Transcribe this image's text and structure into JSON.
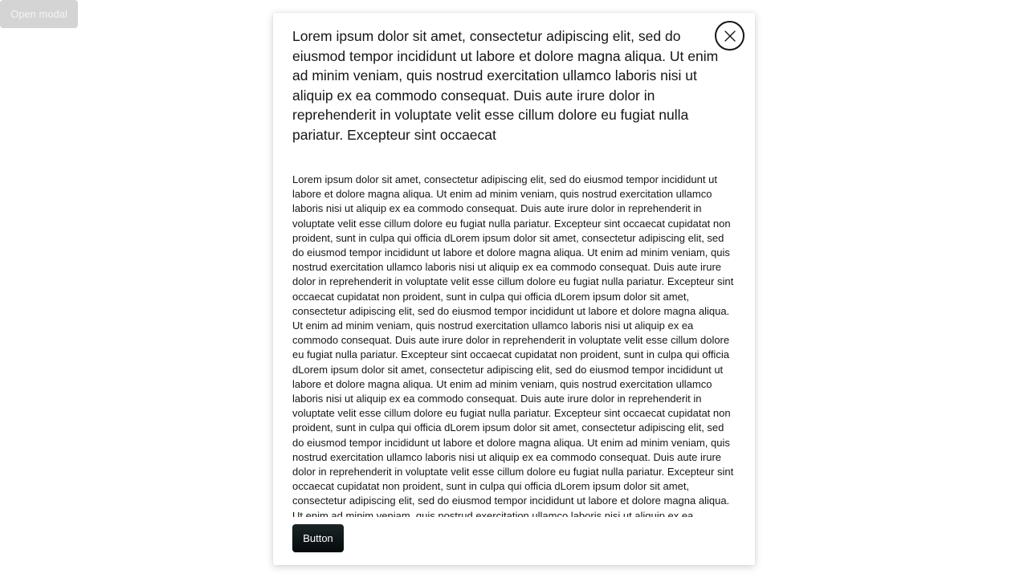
{
  "open_modal": {
    "label": "Open modal"
  },
  "modal": {
    "title": "Lorem ipsum dolor sit amet, consectetur adipiscing elit, sed do eiusmod tempor incididunt ut labore et dolore magna aliqua. Ut enim ad minim veniam, quis nostrud exercitation ullamco laboris nisi ut aliquip ex ea commodo consequat. Duis aute irure dolor in reprehenderit in voluptate velit esse cillum dolore eu fugiat nulla pariatur. Excepteur sint occaecat",
    "close_icon": "close-icon",
    "body": "Lorem ipsum dolor sit amet, consectetur adipiscing elit, sed do eiusmod tempor incididunt ut labore et dolore magna aliqua. Ut enim ad minim veniam, quis nostrud exercitation ullamco laboris nisi ut aliquip ex ea commodo consequat. Duis aute irure dolor in reprehenderit in voluptate velit esse cillum dolore eu fugiat nulla pariatur. Excepteur sint occaecat cupidatat non proident, sunt in culpa qui officia dLorem ipsum dolor sit amet, consectetur adipiscing elit, sed do eiusmod tempor incididunt ut labore et dolore magna aliqua. Ut enim ad minim veniam, quis nostrud exercitation ullamco laboris nisi ut aliquip ex ea commodo consequat. Duis aute irure dolor in reprehenderit in voluptate velit esse cillum dolore eu fugiat nulla pariatur. Excepteur sint occaecat cupidatat non proident, sunt in culpa qui officia dLorem ipsum dolor sit amet, consectetur adipiscing elit, sed do eiusmod tempor incididunt ut labore et dolore magna aliqua. Ut enim ad minim veniam, quis nostrud exercitation ullamco laboris nisi ut aliquip ex ea commodo consequat. Duis aute irure dolor in reprehenderit in voluptate velit esse cillum dolore eu fugiat nulla pariatur. Excepteur sint occaecat cupidatat non proident, sunt in culpa qui officia dLorem ipsum dolor sit amet, consectetur adipiscing elit, sed do eiusmod tempor incididunt ut labore et dolore magna aliqua. Ut enim ad minim veniam, quis nostrud exercitation ullamco laboris nisi ut aliquip ex ea commodo consequat. Duis aute irure dolor in reprehenderit in voluptate velit esse cillum dolore eu fugiat nulla pariatur. Excepteur sint occaecat cupidatat non proident, sunt in culpa qui officia dLorem ipsum dolor sit amet, consectetur adipiscing elit, sed do eiusmod tempor incididunt ut labore et dolore magna aliqua. Ut enim ad minim veniam, quis nostrud exercitation ullamco laboris nisi ut aliquip ex ea commodo consequat. Duis aute irure dolor in reprehenderit in voluptate velit esse cillum dolore eu fugiat nulla pariatur. Excepteur sint occaecat cupidatat non proident, sunt in culpa qui officia dLorem ipsum dolor sit amet, consectetur adipiscing elit, sed do eiusmod tempor incididunt ut labore et dolore magna aliqua. Ut enim ad minim veniam, quis nostrud exercitation ullamco laboris nisi ut aliquip ex ea",
    "button_label": "Button"
  },
  "colors": {
    "open_modal_bg": "#d4d4d4",
    "text": "#161616",
    "primary_button": "#0a1214"
  }
}
